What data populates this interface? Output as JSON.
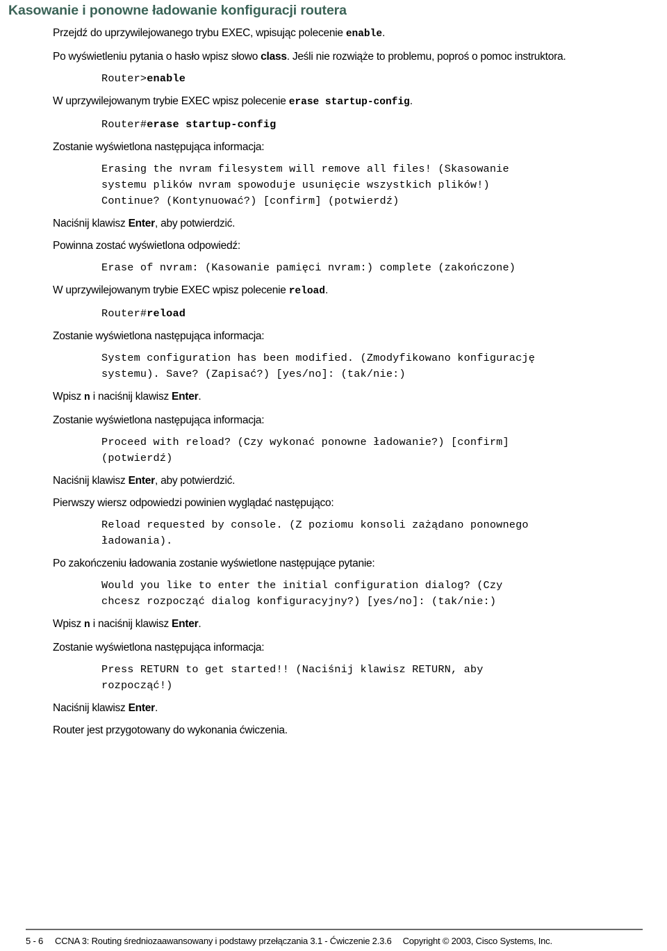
{
  "document": {
    "heading": "Kasowanie i ponowne ładowanie konfiguracji routera",
    "steps": [
      {
        "id": "step-1",
        "type": "paragraph",
        "segments": [
          {
            "text": "Przejdź do uprzywilejowanego trybu EXEC, wpisując polecenie ",
            "style": "normal"
          },
          {
            "text": "enable",
            "style": "mono-bold"
          },
          {
            "text": ".",
            "style": "normal"
          }
        ],
        "plain": "Przejdź do uprzywilejowanego trybu EXEC, wpisując polecenie enable."
      },
      {
        "id": "step-2",
        "type": "paragraph",
        "segments": [
          {
            "text": "Po wyświetleniu pytania o hasło wpisz słowo ",
            "style": "normal"
          },
          {
            "text": "class",
            "style": "bold"
          },
          {
            "text": ". Jeśli nie rozwiąże to problemu, poproś o pomoc instruktora.",
            "style": "normal"
          }
        ],
        "plain": "Po wyświetleniu pytania o hasło wpisz słowo class. Jeśli nie rozwiąże to problemu, poproś o pomoc instruktora."
      },
      {
        "id": "cli-1",
        "type": "cli",
        "prompt": "Router>",
        "command": "enable"
      },
      {
        "id": "step-3",
        "type": "paragraph",
        "segments": [
          {
            "text": "W uprzywilejowanym trybie EXEC wpisz polecenie ",
            "style": "normal"
          },
          {
            "text": "erase startup-config",
            "style": "mono-bold"
          },
          {
            "text": ".",
            "style": "normal"
          }
        ],
        "plain": "W uprzywilejowanym trybie EXEC wpisz polecenie erase startup-config."
      },
      {
        "id": "cli-2",
        "type": "cli",
        "prompt": "Router#",
        "command": "erase startup-config"
      },
      {
        "id": "step-4",
        "type": "paragraph",
        "plain": "Zostanie wyświetlona następująca informacja:"
      },
      {
        "id": "output-1",
        "type": "output",
        "lines": [
          "Erasing the nvram filesystem will remove all files! (Skasowanie",
          "systemu plików nvram spowoduje usunięcie wszystkich plików!)",
          "Continue? (Kontynuować?) [confirm] (potwierdź)"
        ]
      },
      {
        "id": "step-5",
        "type": "paragraph",
        "segments": [
          {
            "text": "Naciśnij klawisz ",
            "style": "normal"
          },
          {
            "text": "Enter",
            "style": "bold"
          },
          {
            "text": ", aby potwierdzić.",
            "style": "normal"
          }
        ],
        "plain": "Naciśnij klawisz Enter, aby potwierdzić."
      },
      {
        "id": "step-6",
        "type": "paragraph",
        "plain": "Powinna zostać wyświetlona odpowiedź:"
      },
      {
        "id": "output-2",
        "type": "output",
        "lines": [
          "Erase of nvram: (Kasowanie pamięci nvram:) complete (zakończone)"
        ]
      },
      {
        "id": "step-7",
        "type": "paragraph",
        "segments": [
          {
            "text": "W uprzywilejowanym trybie EXEC wpisz polecenie ",
            "style": "normal"
          },
          {
            "text": "reload",
            "style": "mono-bold"
          },
          {
            "text": ".",
            "style": "normal"
          }
        ],
        "plain": "W uprzywilejowanym trybie EXEC wpisz polecenie reload."
      },
      {
        "id": "cli-3",
        "type": "cli",
        "prompt": "Router#",
        "command": "reload"
      },
      {
        "id": "step-8",
        "type": "paragraph",
        "plain": "Zostanie wyświetlona następująca informacja:"
      },
      {
        "id": "output-3",
        "type": "output",
        "lines": [
          "System configuration has been modified. (Zmodyfikowano konfigurację",
          "systemu). Save? (Zapisać?) [yes/no]: (tak/nie:)"
        ]
      },
      {
        "id": "step-9",
        "type": "paragraph",
        "segments": [
          {
            "text": "Wpisz ",
            "style": "normal"
          },
          {
            "text": "n",
            "style": "mono-bold"
          },
          {
            "text": " i naciśnij klawisz ",
            "style": "normal"
          },
          {
            "text": "Enter",
            "style": "bold"
          },
          {
            "text": ".",
            "style": "normal"
          }
        ],
        "plain": "Wpisz n i naciśnij klawisz Enter."
      },
      {
        "id": "step-10",
        "type": "paragraph",
        "plain": "Zostanie wyświetlona następująca informacja:"
      },
      {
        "id": "output-4",
        "type": "output",
        "lines": [
          "Proceed with reload? (Czy wykonać ponowne ładowanie?) [confirm]",
          "(potwierdź)"
        ]
      },
      {
        "id": "step-11",
        "type": "paragraph",
        "segments": [
          {
            "text": "Naciśnij klawisz ",
            "style": "normal"
          },
          {
            "text": "Enter",
            "style": "bold"
          },
          {
            "text": ", aby potwierdzić.",
            "style": "normal"
          }
        ],
        "plain": "Naciśnij klawisz Enter, aby potwierdzić."
      },
      {
        "id": "step-12",
        "type": "paragraph",
        "plain": "Pierwszy wiersz odpowiedzi powinien wyglądać następująco:"
      },
      {
        "id": "output-5",
        "type": "output",
        "lines": [
          "Reload requested by console. (Z poziomu konsoli zażądano ponownego",
          "ładowania)."
        ]
      },
      {
        "id": "step-13",
        "type": "paragraph",
        "plain": "Po zakończeniu ładowania zostanie wyświetlone następujące pytanie:"
      },
      {
        "id": "output-6",
        "type": "output",
        "lines": [
          "Would you like to enter the initial configuration dialog? (Czy",
          "chcesz rozpocząć dialog konfiguracyjny?) [yes/no]: (tak/nie:)"
        ]
      },
      {
        "id": "step-14",
        "type": "paragraph",
        "segments": [
          {
            "text": "Wpisz ",
            "style": "normal"
          },
          {
            "text": "n",
            "style": "mono-bold"
          },
          {
            "text": " i naciśnij klawisz ",
            "style": "normal"
          },
          {
            "text": "Enter",
            "style": "bold"
          },
          {
            "text": ".",
            "style": "normal"
          }
        ],
        "plain": "Wpisz n i naciśnij klawisz Enter."
      },
      {
        "id": "step-15",
        "type": "paragraph",
        "plain": "Zostanie wyświetlona następująca informacja:"
      },
      {
        "id": "output-7",
        "type": "output",
        "lines": [
          "Press RETURN to get started!! (Naciśnij klawisz RETURN, aby",
          "rozpocząć!)"
        ]
      },
      {
        "id": "step-16",
        "type": "paragraph",
        "segments": [
          {
            "text": "Naciśnij klawisz ",
            "style": "normal"
          },
          {
            "text": "Enter",
            "style": "bold"
          },
          {
            "text": ".",
            "style": "normal"
          }
        ],
        "plain": "Naciśnij klawisz Enter."
      },
      {
        "id": "step-17",
        "type": "paragraph",
        "plain": "Router jest przygotowany do wykonania ćwiczenia."
      }
    ]
  },
  "footer": {
    "page_number": "5 - 6",
    "course_title": "CCNA 3: Routing średniozaawansowany i podstawy przełączania 3.1 - Ćwiczenie 2.3.6",
    "copyright": "Copyright © 2003, Cisco Systems, Inc."
  },
  "colors": {
    "heading": "#3b6357",
    "body": "#000000",
    "rule": "#6b6b6b",
    "background": "#ffffff"
  }
}
